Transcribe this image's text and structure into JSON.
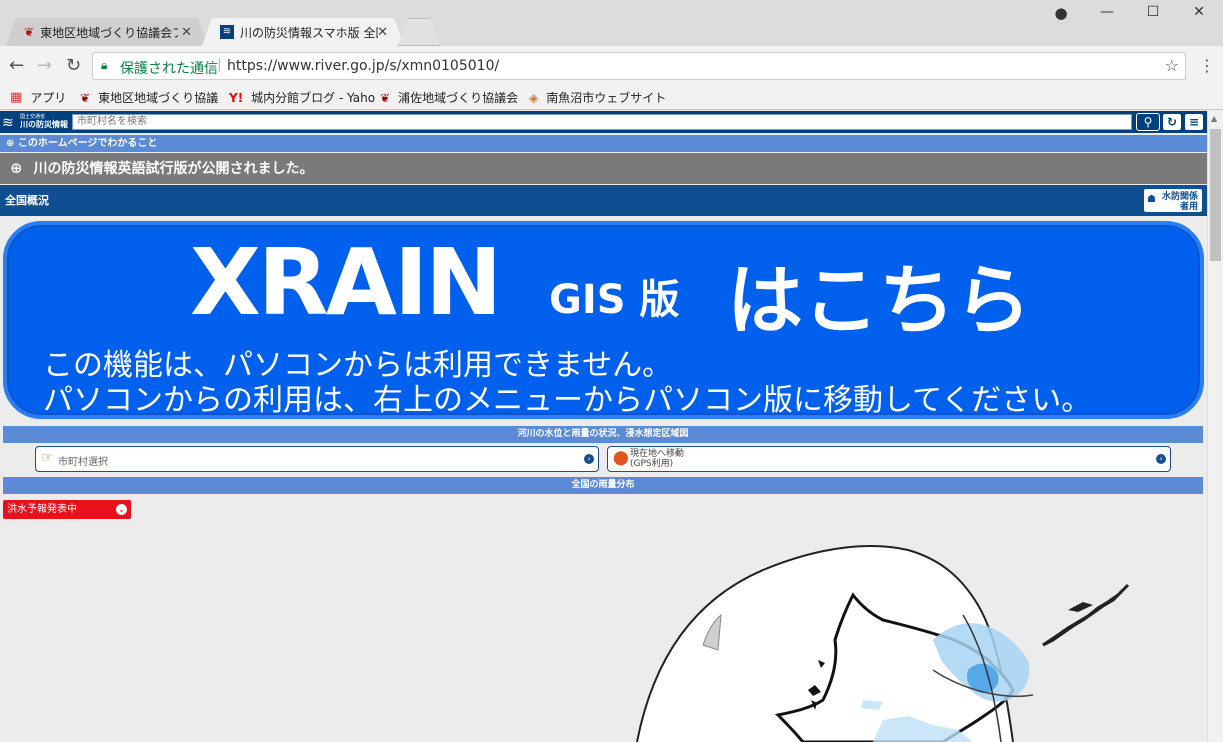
{
  "browser": {
    "tabs": [
      {
        "title": "東地区地域づくり協議会ブロ",
        "active": false
      },
      {
        "title": "川の防災情報スマホ版 全国",
        "active": true
      }
    ],
    "secure_label": "保護された通信",
    "url": "https://www.river.go.jp/s/xmn0105010/",
    "bookmarks": [
      {
        "label": "アプリ",
        "icon": "apps-grid-icon"
      },
      {
        "label": "東地区地域づくり協議",
        "icon": "site-logo-icon"
      },
      {
        "label": "城内分館ブログ - Yaho",
        "icon": "yahoo-icon"
      },
      {
        "label": "浦佐地域づくり協議会",
        "icon": "site-logo-icon"
      },
      {
        "label": "南魚沼市ウェブサイト",
        "icon": "city-logo-icon"
      }
    ]
  },
  "site": {
    "logo_small": "国土交通省",
    "logo_main": "川の防災情報",
    "search_placeholder": "市町村名を検索",
    "about_label": "このホームページでわかること",
    "notice": "川の防災情報英語試行版が公開されました。",
    "overview_label": "全国概況",
    "flood_button_line1": "水防関係",
    "flood_button_line2": "者用",
    "banner": {
      "title": "XRAIN",
      "gis": "GIS 版",
      "kochira": "はこちら",
      "line1": "この機能は、パソコンからは利用できません。",
      "line2": "パソコンからの利用は、右上のメニューからパソコン版に移動してください。"
    },
    "section1": "河川の水位と雨量の状況、浸水想定区域図",
    "municipality_select": "市町村選択",
    "gps_line1": "現在地へ移動",
    "gps_line2": "(GPS利用)",
    "section2": "全国の雨量分布",
    "forecast_label": "洪水予報発表中"
  },
  "colors": {
    "header_blue": "#00407f",
    "section_blue": "#5b8bd6",
    "banner_blue": "#0060ee",
    "alert_red": "#e8101a"
  }
}
